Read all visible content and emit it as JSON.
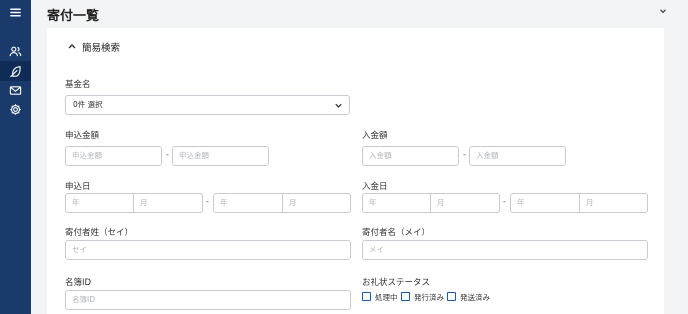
{
  "header": {
    "title": "寄付一覧"
  },
  "search": {
    "toggle_label": "簡易検索",
    "fund_name": {
      "label": "基金名",
      "value": "0件 選択"
    },
    "apply_amount": {
      "label": "申込金額",
      "from_placeholder": "申込金額",
      "to_placeholder": "申込金額",
      "separator": "-"
    },
    "deposit_amount": {
      "label": "入金額",
      "from_placeholder": "入金額",
      "to_placeholder": "入金額",
      "separator": "-"
    },
    "apply_date": {
      "label": "申込日",
      "year_placeholder": "年",
      "month_placeholder": "月",
      "separator": "-"
    },
    "deposit_date": {
      "label": "入金日",
      "year_placeholder": "年",
      "month_placeholder": "月",
      "separator": "-"
    },
    "last_name_kana": {
      "label": "寄付者姓（セイ）",
      "placeholder": "セイ"
    },
    "first_name_kana": {
      "label": "寄付者名（メイ）",
      "placeholder": "メイ"
    },
    "register_id": {
      "label": "名簿ID",
      "placeholder": "名簿ID"
    },
    "thanks_status": {
      "label": "お礼状ステータス",
      "options": [
        {
          "label": "処理中",
          "checked": false
        },
        {
          "label": "発行済み",
          "checked": false
        },
        {
          "label": "発送済み",
          "checked": false
        }
      ]
    }
  },
  "sidebar": {
    "icons": [
      "menu-icon",
      "users-icon",
      "feather-icon",
      "mail-icon",
      "gear-icon"
    ],
    "active": "feather-icon"
  },
  "colors": {
    "sidebar": "#1a3a6b",
    "sidebar_active": "#0f2c56",
    "checkbox": "#1a5aa8",
    "border": "#c8ccd2"
  }
}
